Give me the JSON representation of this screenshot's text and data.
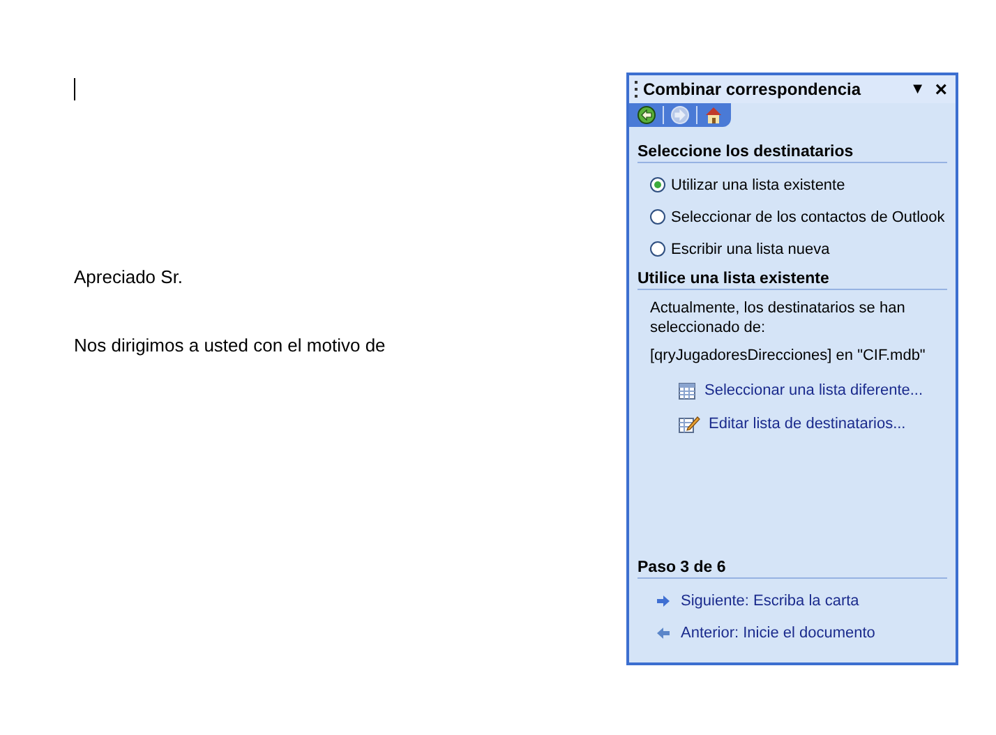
{
  "document": {
    "paragraphs": [
      "Apreciado Sr.",
      "Nos dirigimos a usted con el motivo de"
    ]
  },
  "task_pane": {
    "title": "Combinar correspondencia",
    "menu_glyph": "▼",
    "close_glyph": "×",
    "nav_buttons": [
      {
        "kind": "back",
        "disabled": false
      },
      {
        "kind": "forward",
        "disabled": true
      },
      {
        "kind": "home",
        "disabled": false
      }
    ],
    "sections": [
      {
        "heading": "Seleccione los destinatarios",
        "options": [
          {
            "label": "Utilizar una lista existente",
            "selected": true
          },
          {
            "label": "Seleccionar de los contactos de Outlook",
            "selected": false
          },
          {
            "label": "Escribir una lista nueva",
            "selected": false
          }
        ]
      },
      {
        "heading": "Utilice una lista existente",
        "text": "Actualmente, los destinatarios se han seleccionado de:",
        "source": "[qryJugadoresDirecciones] en \"CIF.mdb\"",
        "links": [
          {
            "kind": "table",
            "label": "Seleccionar una lista diferente..."
          },
          {
            "kind": "edit",
            "label": "Editar lista de destinatarios..."
          }
        ]
      }
    ],
    "step": {
      "heading": "Paso 3 de 6",
      "links": [
        {
          "kind": "next",
          "label": "Siguiente: Escriba la carta"
        },
        {
          "kind": "prev",
          "label": "Anterior: Inicie el documento"
        }
      ]
    }
  }
}
